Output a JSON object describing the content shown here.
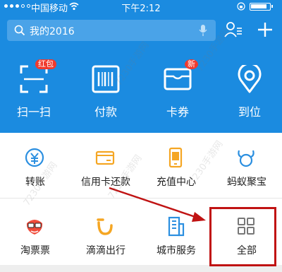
{
  "status_bar": {
    "carrier": "中国移动",
    "time": "下午2:12"
  },
  "search": {
    "text": "我的2016"
  },
  "top_actions": [
    {
      "label": "扫一扫",
      "icon": "scan-icon",
      "badge": "红包"
    },
    {
      "label": "付款",
      "icon": "barcode-icon"
    },
    {
      "label": "卡券",
      "icon": "card-wallet-icon",
      "badge": "新"
    },
    {
      "label": "到位",
      "icon": "location-pin-icon"
    }
  ],
  "grid": [
    {
      "label": "转账",
      "icon": "transfer-icon"
    },
    {
      "label": "信用卡还款",
      "icon": "credit-card-icon"
    },
    {
      "label": "充值中心",
      "icon": "phone-recharge-icon"
    },
    {
      "label": "蚂蚁聚宝",
      "icon": "ant-fortune-icon"
    },
    {
      "label": "淘票票",
      "icon": "taopiaopiao-icon"
    },
    {
      "label": "滴滴出行",
      "icon": "didi-icon"
    },
    {
      "label": "城市服务",
      "icon": "city-service-icon"
    },
    {
      "label": "全部",
      "icon": "all-apps-icon"
    }
  ],
  "watermark": "7230手游网",
  "colors": {
    "header_blue": "#1b8be0",
    "highlight_red": "#c01313",
    "badge_red": "#f03a2e",
    "icon_orange": "#f5a623",
    "icon_blue": "#2b8fe0"
  }
}
